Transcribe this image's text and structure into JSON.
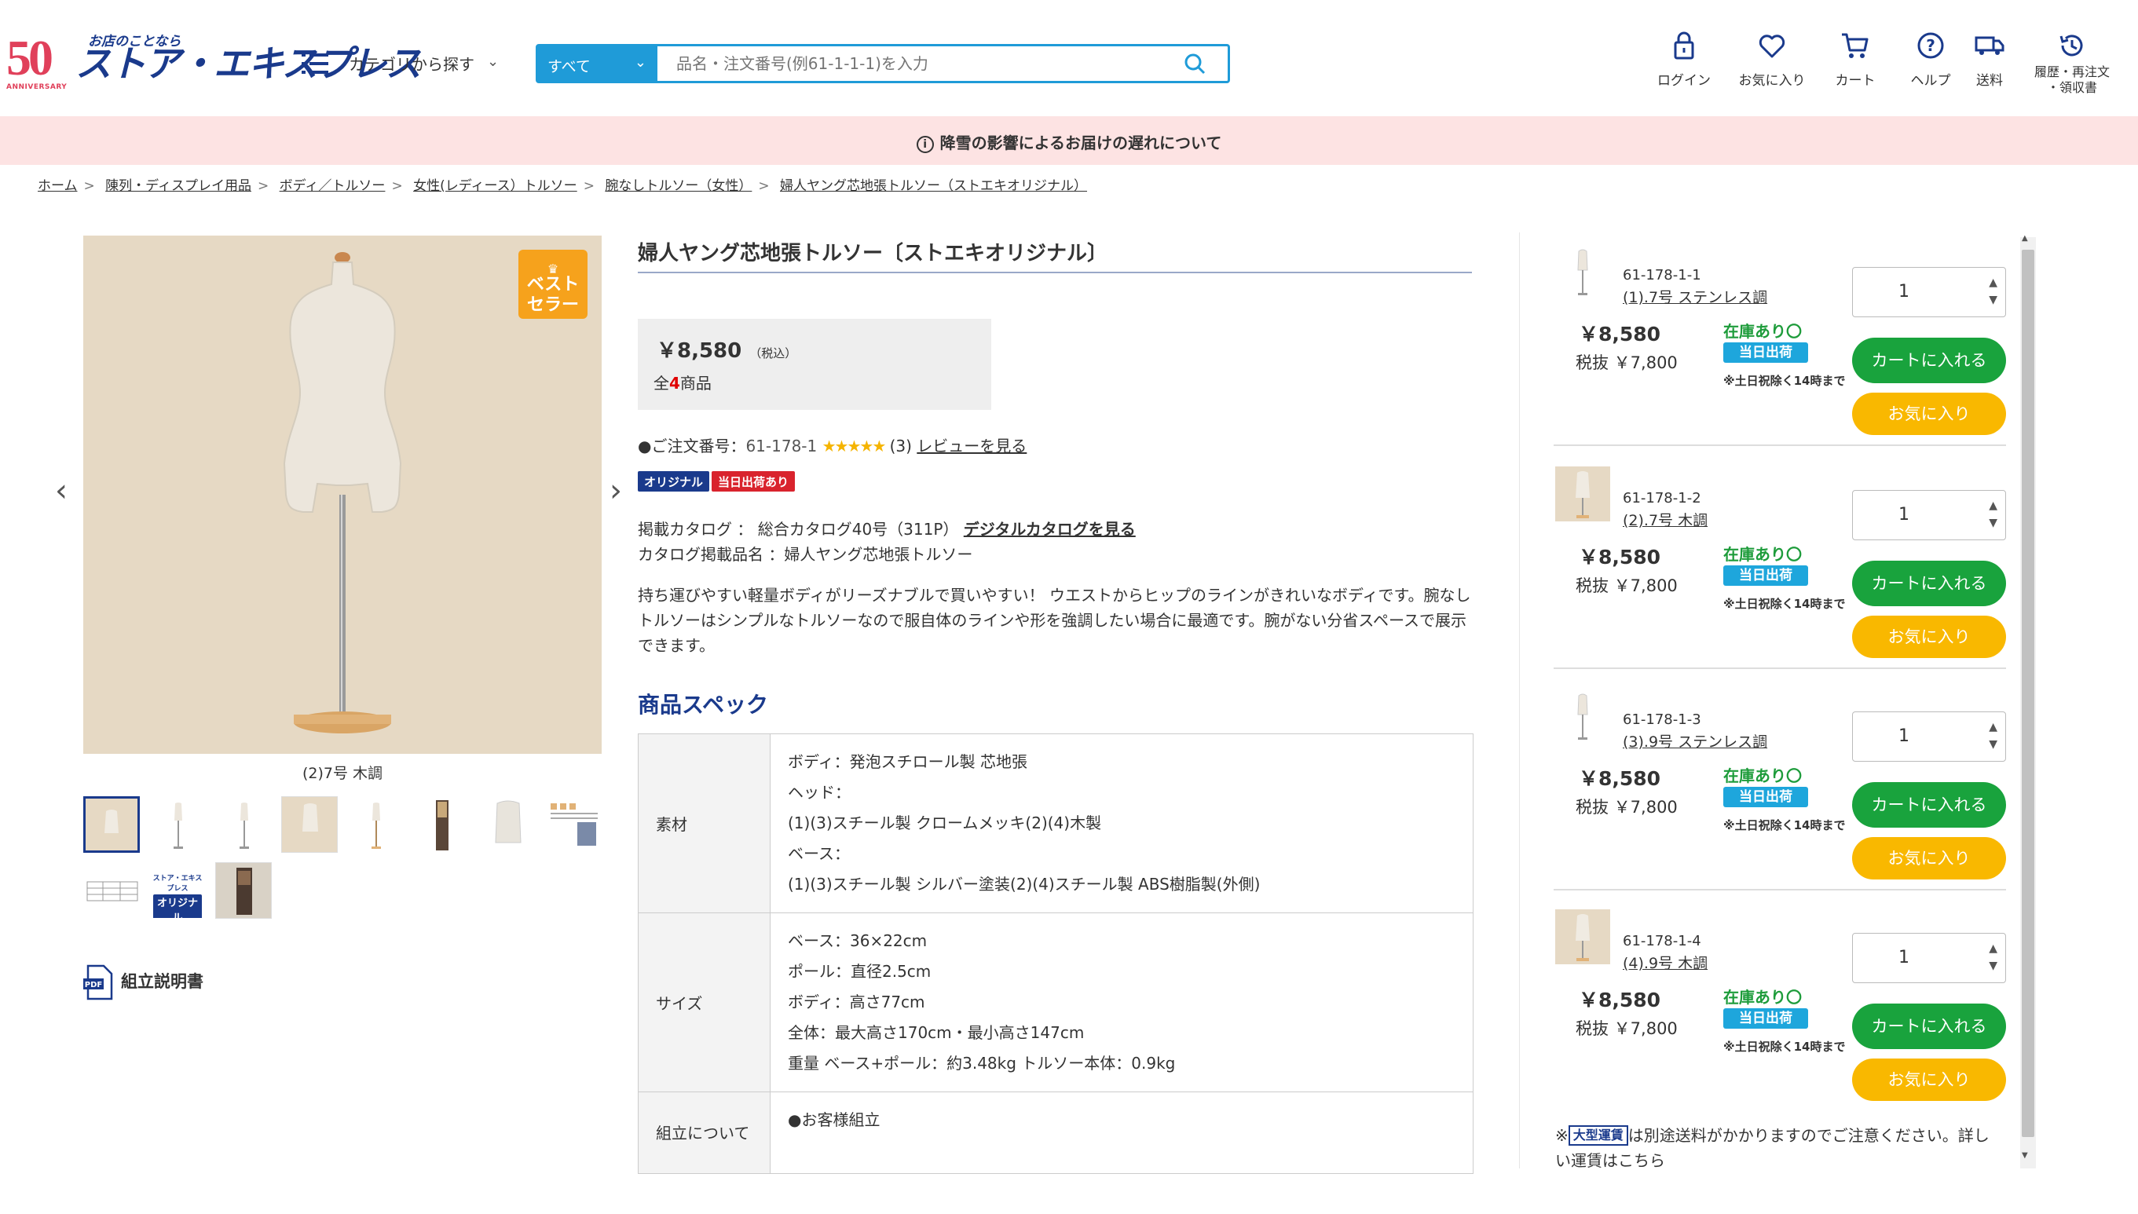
{
  "header": {
    "logo_number": "50",
    "logo_sub": "ANNIVERSARY",
    "brand_tagline": "お店のことなら",
    "brand_name": "ストア・エキスプレス",
    "category_label": "カテゴリから探す",
    "search": {
      "scope": "すべて",
      "placeholder": "品名・注文番号(例61-1-1-1)を入力"
    },
    "icons": [
      {
        "label": "ログイン",
        "icon": "lock-icon"
      },
      {
        "label": "お気に入り",
        "icon": "heart-icon"
      },
      {
        "label": "カート",
        "icon": "cart-icon"
      },
      {
        "label": "ヘルプ",
        "icon": "help-icon"
      },
      {
        "label": "送料",
        "icon": "truck-icon"
      },
      {
        "label_line1": "履歴・再注文",
        "label_line2": "・領収書",
        "icon": "history-icon"
      }
    ]
  },
  "notice": {
    "text": "降雪の影響によるお届けの遅れについて"
  },
  "breadcrumb": [
    "ホーム",
    "陳列・ディスプレイ用品",
    "ボディ／トルソー",
    "女性(レディース）トルソー",
    "腕なしトルソー（女性）",
    "婦人ヤング芯地張トルソー（ストエキオリジナル）"
  ],
  "gallery": {
    "badge_line1": "ベスト",
    "badge_line2": "セラー",
    "caption": "(2)7号 木調",
    "thumb_text_original_line1": "ストア・エキスプレス",
    "thumb_text_original_line2": "オリジナル",
    "pdf_label": "組立説明書",
    "pdf_icon_text": "PDF"
  },
  "product": {
    "title": "婦人ヤング芯地張トルソー〔ストエキオリジナル〕",
    "price": "￥8,580",
    "tax_note": "（税込）",
    "count_prefix": "全",
    "count": "4",
    "count_suffix": "商品",
    "order_label": "●ご注文番号：",
    "order_no": "61-178-1",
    "stars": "★★★★★",
    "rating": 5,
    "review_count": "(3)",
    "review_link": "レビューを見る",
    "tags": [
      {
        "label": "オリジナル",
        "color": "#1a3a8c"
      },
      {
        "label": "当日出荷あり",
        "color": "#d9232d"
      }
    ],
    "catalog_label": "掲載カタログ ： 総合カタログ40号（311P）",
    "catalog_link": "デジタルカタログを見る",
    "catalog_name": "カタログ掲載品名 ：婦人ヤング芯地張トルソー",
    "description": "持ち運びやすい軽量ボディがリーズナブルで買いやすい！ ウエストからヒップのラインがきれいなボディです。腕なしトルソーはシンプルなトルソーなので服自体のラインや形を強調したい場合に最適です。腕がない分省スペースで展示できます。"
  },
  "spec": {
    "title": "商品スペック",
    "rows": [
      {
        "key": "素材",
        "lines": [
          "ボディ：発泡スチロール製 芯地張",
          "ヘッド：",
          "(1)(3)スチール製 クロームメッキ(2)(4)木製",
          "ベース：",
          "(1)(3)スチール製 シルバー塗装(2)(4)スチール製 ABS樹脂製(外側)"
        ]
      },
      {
        "key": "サイズ",
        "lines": [
          "ベース：36×22cm",
          "ポール：直径2.5cm",
          "ボディ：高さ77cm",
          "全体：最大高さ170cm・最小高さ147cm",
          "重量 ベース+ポール：約3.48kg トルソー本体：0.9kg"
        ]
      },
      {
        "key": "組立について",
        "lines": [
          "●お客様組立"
        ]
      }
    ]
  },
  "variants": [
    {
      "code": "61-178-1-1",
      "name": "(1).7号 ステンレス調",
      "price": "￥8,580",
      "ex_price": "税抜 ￥7,800",
      "stock": "在庫あり〇",
      "same_day": "当日出荷",
      "note": "※土日祝除く14時まで",
      "qty": "1",
      "cart": "カートに入れる",
      "fav": "お気に入り"
    },
    {
      "code": "61-178-1-2",
      "name": "(2).7号 木調",
      "price": "￥8,580",
      "ex_price": "税抜 ￥7,800",
      "stock": "在庫あり〇",
      "same_day": "当日出荷",
      "note": "※土日祝除く14時まで",
      "qty": "1",
      "cart": "カートに入れる",
      "fav": "お気に入り"
    },
    {
      "code": "61-178-1-3",
      "name": "(3).9号 ステンレス調",
      "price": "￥8,580",
      "ex_price": "税抜 ￥7,800",
      "stock": "在庫あり〇",
      "same_day": "当日出荷",
      "note": "※土日祝除く14時まで",
      "qty": "1",
      "cart": "カートに入れる",
      "fav": "お気に入り"
    },
    {
      "code": "61-178-1-4",
      "name": "(4).9号 木調",
      "price": "￥8,580",
      "ex_price": "税抜 ￥7,800",
      "stock": "在庫あり〇",
      "same_day": "当日出荷",
      "note": "※土日祝除く14時まで",
      "qty": "1",
      "cart": "カートに入れる",
      "fav": "お気に入り"
    }
  ],
  "footnote": {
    "prefix": "※",
    "badge": "大型運賃",
    "text": "は別途送料がかかりますのでご注意ください。詳しい運賃はこちら"
  },
  "colors": {
    "brand": "#1a3a8c",
    "search": "#1f9bd8",
    "cart": "#19a33d",
    "fav": "#f9b800",
    "notice_bg": "#fde3e3",
    "stock": "#1e9c3b"
  }
}
